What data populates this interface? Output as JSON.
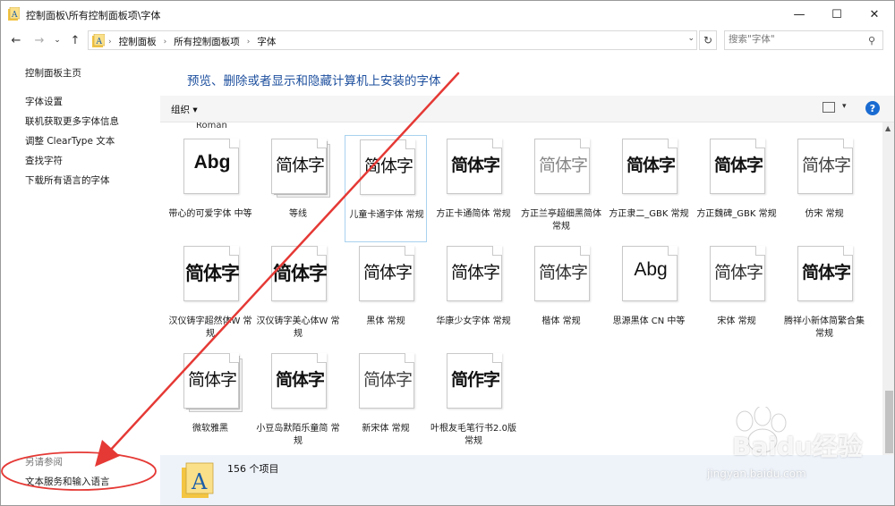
{
  "window": {
    "title": "控制面板\\所有控制面板项\\字体",
    "minimize_glyph": "—",
    "maximize_glyph": "☐",
    "close_glyph": "✕"
  },
  "nav": {
    "back_glyph": "←",
    "forward_glyph": "→",
    "recent_glyph": "⌄",
    "up_glyph": "↑",
    "breadcrumbs": [
      "控制面板",
      "所有控制面板项",
      "字体"
    ],
    "separator": "›",
    "dropdown_glyph": "⌄",
    "refresh_glyph": "↻",
    "search_placeholder": "搜索\"字体\"",
    "search_glyph": "⚲"
  },
  "sidebar": {
    "home": "控制面板主页",
    "links": [
      "字体设置",
      "联机获取更多字体信息",
      "调整 ClearType 文本",
      "查找字符",
      "下载所有语言的字体"
    ],
    "see_also_title": "另请参阅",
    "see_also_link": "文本服务和输入语言"
  },
  "main": {
    "heading": "预览、删除或者显示和隐藏计算机上安装的字体",
    "organize": "组织 ▾",
    "view_dropdown": "▾",
    "help": "?",
    "partial_label": "Roman"
  },
  "fonts": [
    {
      "sample": "Abg",
      "label": "带心的可爱字体 中等"
    },
    {
      "sample": "简体字",
      "label": "等线"
    },
    {
      "sample": "简体字",
      "label": "儿童卡通字体 常规"
    },
    {
      "sample": "简体字",
      "label": "方正卡通简体 常规"
    },
    {
      "sample": "简体字",
      "label": "方正兰亭超细黑简体 常规"
    },
    {
      "sample": "简体字",
      "label": "方正隶二_GBK 常规"
    },
    {
      "sample": "简体字",
      "label": "方正魏碑_GBK 常规"
    },
    {
      "sample": "简体字",
      "label": "仿宋 常规"
    },
    {
      "sample": "简体字",
      "label": "汉仪铸字超然体W 常规"
    },
    {
      "sample": "简体字",
      "label": "汉仪铸字美心体W 常规"
    },
    {
      "sample": "简体字",
      "label": "黑体 常规"
    },
    {
      "sample": "简体字",
      "label": "华康少女字体 常规"
    },
    {
      "sample": "简体字",
      "label": "楷体 常规"
    },
    {
      "sample": "Abg",
      "label": "思源黑体 CN 中等"
    },
    {
      "sample": "简体字",
      "label": "宋体 常规"
    },
    {
      "sample": "简体字",
      "label": "腾祥小新体简繁合集 常规"
    },
    {
      "sample": "简体字",
      "label": "微软雅黑"
    },
    {
      "sample": "简体字",
      "label": "小豆岛默陌乐童简 常规"
    },
    {
      "sample": "简体字",
      "label": "新宋体 常规"
    },
    {
      "sample": "简作字",
      "label": "叶根友毛笔行书2.0版 常规"
    }
  ],
  "status": {
    "count": "156 个项目"
  },
  "scrollbar": {
    "up_glyph": "▲"
  },
  "watermark": {
    "brand": "Baidu经验",
    "url": "jingyan.baidu.com"
  },
  "colors": {
    "heading": "#1d4f9e",
    "selection_border": "#a8d2ef",
    "details_bg": "#eef3fa",
    "annotation_red": "#e53935"
  }
}
